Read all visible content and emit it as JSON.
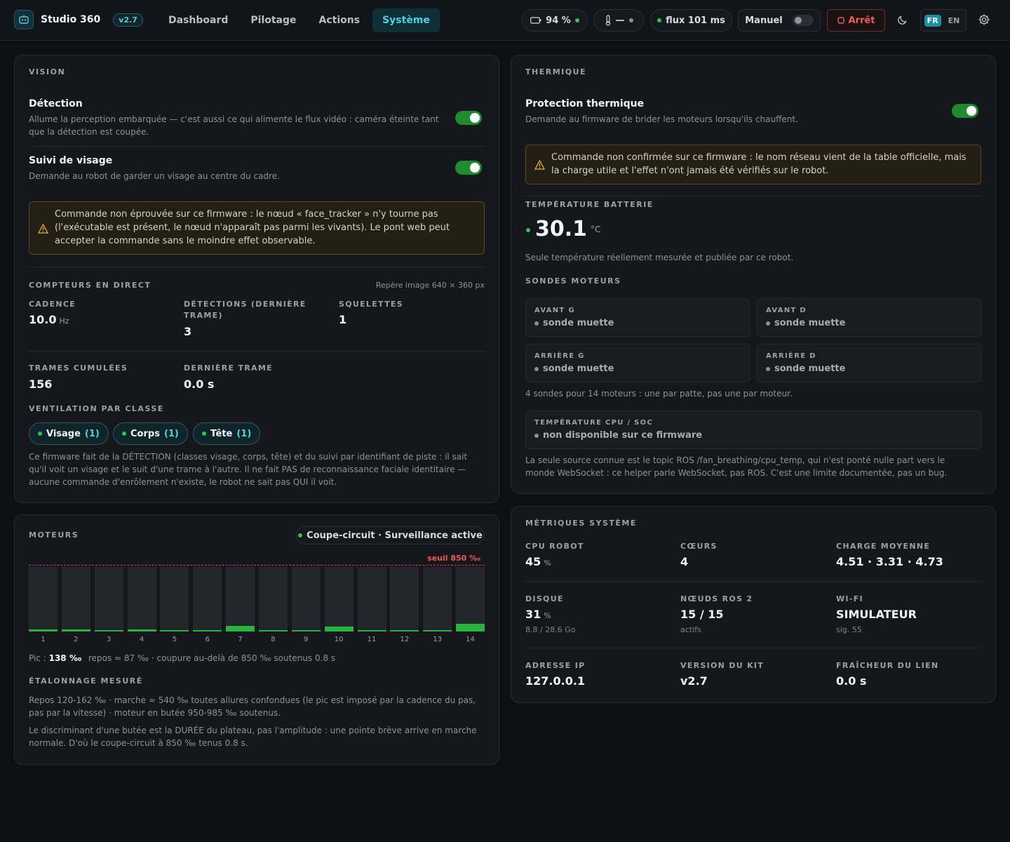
{
  "topbar": {
    "app_title": "Studio 360",
    "version": "v2.7",
    "nav": [
      "Dashboard",
      "Pilotage",
      "Actions",
      "Système"
    ],
    "active_nav": "Système",
    "battery": "94 %",
    "temp_status": "—",
    "flux": "flux 101 ms",
    "mode": "Manuel",
    "stop": "Arrêt",
    "lang_fr": "FR",
    "lang_en": "EN"
  },
  "vision": {
    "title": "VISION",
    "detection_title": "Détection",
    "detection_desc": "Allume la perception embarquée — c'est aussi ce qui alimente le flux vidéo : caméra éteinte tant que la détection est coupée.",
    "tracking_title": "Suivi de visage",
    "tracking_desc": "Demande au robot de garder un visage au centre du cadre.",
    "warning": "Commande non éprouvée sur ce firmware : le nœud « face_tracker » n'y tourne pas (l'exécutable est présent, le nœud n'apparaît pas parmi les vivants). Le pont web peut accepter la commande sans le moindre effet observable.",
    "counters_title": "COMPTEURS EN DIRECT",
    "frame_ref": "Repère image 640 × 360 px",
    "cadence_label": "CADENCE",
    "cadence_value": "10.0",
    "cadence_unit": "Hz",
    "detections_label": "DÉTECTIONS (DERNIÈRE TRAME)",
    "detections_value": "3",
    "skeletons_label": "SQUELETTES",
    "skeletons_value": "1",
    "frames_label": "TRAMES CUMULÉES",
    "frames_value": "156",
    "last_frame_label": "DERNIÈRE TRAME",
    "last_frame_value": "0.0 s",
    "breakdown_title": "VENTILATION PAR CLASSE",
    "classes": [
      {
        "name": "Visage",
        "count": "(1)"
      },
      {
        "name": "Corps",
        "count": "(1)"
      },
      {
        "name": "Tête",
        "count": "(1)"
      }
    ],
    "footnote": "Ce firmware fait de la DÉTECTION (classes visage, corps, tête) et du suivi par identifiant de piste : il sait qu'il voit un visage et le suit d'une trame à l'autre. Il ne fait PAS de reconnaissance faciale identitaire — aucune commande d'enrôlement n'existe, le robot ne sait pas QUI il voit."
  },
  "motors": {
    "title": "MOTEURS",
    "breaker_badge": "Coupe-circuit · Surveillance active",
    "threshold_label": "seuil 850 ‰",
    "threshold": 850,
    "max": 1000,
    "loads": [
      34,
      34,
      18,
      28,
      22,
      18,
      87,
      18,
      18,
      77,
      18,
      18,
      24,
      125
    ],
    "ticks": [
      "1",
      "2",
      "3",
      "4",
      "5",
      "6",
      "7",
      "8",
      "9",
      "10",
      "11",
      "12",
      "13",
      "14"
    ],
    "peak_label": "Pic :",
    "peak_value": "138 ‰",
    "summary": "repos ≈ 87 ‰ · coupure au-delà de 850 ‰ soutenus 0.8 s",
    "calibration_title": "ÉTALONNAGE MESURÉ",
    "calibration_text": "Repos 120-162 ‰ · marche ≈ 540 ‰ toutes allures confondues (le pic est imposé par la cadence du pas, pas par la vitesse) · moteur en butée 950-985 ‰ soutenus.",
    "calibration_note": "Le discriminant d'une butée est la DURÉE du plateau, pas l'amplitude : une pointe brève arrive en marche normale. D'où le coupe-circuit à 850 ‰ tenus 0.8 s."
  },
  "thermal": {
    "title": "THERMIQUE",
    "protection_title": "Protection thermique",
    "protection_desc": "Demande au firmware de brider les moteurs lorsqu'ils chauffent.",
    "warning": "Commande non confirmée sur ce firmware : le nom réseau vient de la table officielle, mais la charge utile et l'effet n'ont jamais été vérifiés sur le robot.",
    "battery_temp_label": "TEMPÉRATURE BATTERIE",
    "battery_temp_value": "30.1",
    "battery_temp_unit": "°C",
    "battery_temp_note": "Seule température réellement mesurée et publiée par ce robot.",
    "probes_title": "SONDES MOTEURS",
    "probes": [
      {
        "label": "AVANT G",
        "status": "sonde muette"
      },
      {
        "label": "AVANT D",
        "status": "sonde muette"
      },
      {
        "label": "ARRIÈRE G",
        "status": "sonde muette"
      },
      {
        "label": "ARRIÈRE D",
        "status": "sonde muette"
      }
    ],
    "probes_note": "4 sondes pour 14 moteurs : une par patte, pas une par moteur.",
    "cpu_temp_label": "TEMPÉRATURE CPU / SOC",
    "cpu_temp_status": "non disponible sur ce firmware",
    "cpu_note": "La seule source connue est le topic ROS /fan_breathing/cpu_temp, qui n'est ponté nulle part vers le monde WebSocket : ce helper parle WebSocket, pas ROS. C'est une limite documentée, pas un bug."
  },
  "metrics": {
    "title": "MÉTRIQUES SYSTÈME",
    "items": [
      {
        "label": "CPU ROBOT",
        "value": "45",
        "unit": "%",
        "sub": ""
      },
      {
        "label": "CŒURS",
        "value": "4",
        "unit": "",
        "sub": ""
      },
      {
        "label": "CHARGE MOYENNE",
        "value": "4.51 · 3.31 · 4.73",
        "unit": "",
        "sub": ""
      },
      {
        "label": "DISQUE",
        "value": "31",
        "unit": "%",
        "sub": "8.8 / 28.6 Go"
      },
      {
        "label": "NŒUDS ROS 2",
        "value": "15 / 15",
        "unit": "",
        "sub": "actifs"
      },
      {
        "label": "WI-FI",
        "value": "SIMULATEUR",
        "unit": "",
        "sub": "sig. 55"
      },
      {
        "label": "ADRESSE IP",
        "value": "127.0.0.1",
        "unit": "",
        "sub": ""
      },
      {
        "label": "VERSION DU KIT",
        "value": "v2.7",
        "unit": "",
        "sub": ""
      },
      {
        "label": "FRAÎCHEUR DU LIEN",
        "value": "0.0 s",
        "unit": "",
        "sub": ""
      }
    ]
  },
  "colors": {
    "accent": "#4fd1e0",
    "ok": "#2fc25b",
    "danger": "#ef5a5a",
    "warn_bg": "#241f14"
  }
}
